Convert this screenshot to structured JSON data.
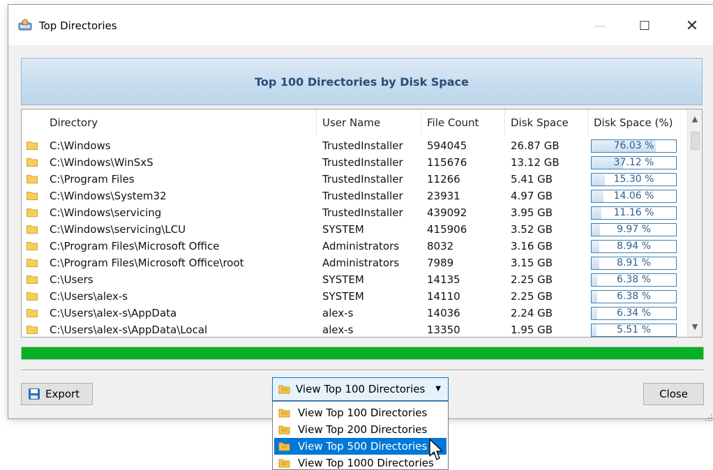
{
  "window": {
    "title": "Top Directories",
    "icons": {
      "app": "disk-analyzer-icon",
      "minimize": "minimize-icon",
      "maximize": "maximize-icon",
      "close": "close-icon"
    },
    "min_glyph": "—",
    "max_glyph": "☐",
    "close_glyph": "✕"
  },
  "banner": {
    "title": "Top 100 Directories by Disk Space"
  },
  "table": {
    "columns": [
      "Directory",
      "User Name",
      "File Count",
      "Disk Space",
      "Disk Space (%)"
    ],
    "rows": [
      {
        "directory": "C:\\Windows",
        "user": "TrustedInstaller",
        "count": "594045",
        "space": "26.87 GB",
        "pct_label": "76.03 %",
        "pct": 76.03
      },
      {
        "directory": "C:\\Windows\\WinSxS",
        "user": "TrustedInstaller",
        "count": "115676",
        "space": "13.12 GB",
        "pct_label": "37.12 %",
        "pct": 37.12
      },
      {
        "directory": "C:\\Program Files",
        "user": "TrustedInstaller",
        "count": "11266",
        "space": "5.41 GB",
        "pct_label": "15.30 %",
        "pct": 15.3
      },
      {
        "directory": "C:\\Windows\\System32",
        "user": "TrustedInstaller",
        "count": "23931",
        "space": "4.97 GB",
        "pct_label": "14.06 %",
        "pct": 14.06
      },
      {
        "directory": "C:\\Windows\\servicing",
        "user": "TrustedInstaller",
        "count": "439092",
        "space": "3.95 GB",
        "pct_label": "11.16 %",
        "pct": 11.16
      },
      {
        "directory": "C:\\Windows\\servicing\\LCU",
        "user": "SYSTEM",
        "count": "415906",
        "space": "3.52 GB",
        "pct_label": "9.97 %",
        "pct": 9.97
      },
      {
        "directory": "C:\\Program Files\\Microsoft Office",
        "user": "Administrators",
        "count": "8032",
        "space": "3.16 GB",
        "pct_label": "8.94 %",
        "pct": 8.94
      },
      {
        "directory": "C:\\Program Files\\Microsoft Office\\root",
        "user": "Administrators",
        "count": "7989",
        "space": "3.15 GB",
        "pct_label": "8.91 %",
        "pct": 8.91
      },
      {
        "directory": "C:\\Users",
        "user": "SYSTEM",
        "count": "14135",
        "space": "2.25 GB",
        "pct_label": "6.38 %",
        "pct": 6.38
      },
      {
        "directory": "C:\\Users\\alex-s",
        "user": "SYSTEM",
        "count": "14110",
        "space": "2.25 GB",
        "pct_label": "6.38 %",
        "pct": 6.38
      },
      {
        "directory": "C:\\Users\\alex-s\\AppData",
        "user": "alex-s",
        "count": "14036",
        "space": "2.24 GB",
        "pct_label": "6.34 %",
        "pct": 6.34
      },
      {
        "directory": "C:\\Users\\alex-s\\AppData\\Local",
        "user": "alex-s",
        "count": "13350",
        "space": "1.95 GB",
        "pct_label": "5.51 %",
        "pct": 5.51
      }
    ],
    "row_icon": "folder-icon",
    "scroll_up_glyph": "▲",
    "scroll_down_glyph": "▼"
  },
  "progress": {
    "value_percent": 100,
    "color": "#06b025"
  },
  "buttons": {
    "export": "Export",
    "close": "Close",
    "export_icon": "save-icon"
  },
  "view_select": {
    "selected": "View Top 100 Directories",
    "arrow_glyph": "▼",
    "options": [
      "View Top 100 Directories",
      "View Top 200 Directories",
      "View Top 500 Directories",
      "View Top 1000 Directories"
    ],
    "highlighted_index": 2
  },
  "colors": {
    "accent": "#0078d7",
    "banner_text": "#2b4d79",
    "pct_border": "#3c7fb1"
  }
}
